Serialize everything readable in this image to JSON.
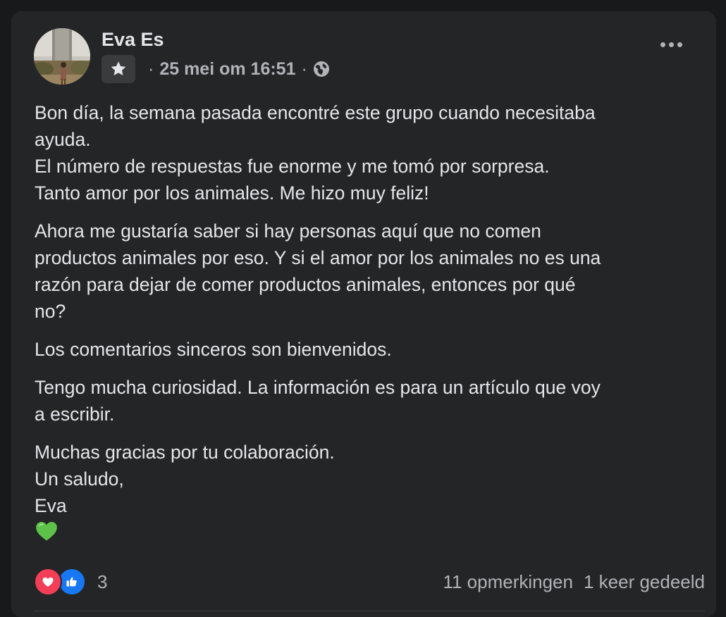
{
  "post": {
    "author": "Eva Es",
    "date": "25 mei om 16:51",
    "separator": "·",
    "paragraphs": [
      [
        "Bon día, la semana pasada encontré este grupo cuando necesitaba",
        "ayuda.",
        "El número de respuestas fue enorme y me tomó por sorpresa.",
        "Tanto amor por los animales. Me hizo muy feliz!"
      ],
      [
        "Ahora me gustaría saber si hay personas aquí que no comen",
        "productos animales por eso. Y si el amor por los animales no es una",
        "razón para dejar de comer productos animales, entonces por qué",
        "no?"
      ],
      [
        "Los comentarios sinceros son bienvenidos."
      ],
      [
        "Tengo mucha curiosidad. La información es para un artículo que voy",
        "a escribir."
      ],
      [
        "Muchas gracias por tu colaboración.",
        "Un saludo,",
        "Eva"
      ]
    ],
    "emoji": "green-heart"
  },
  "footer": {
    "reaction_count": "3",
    "comments": "11 opmerkingen",
    "shares": "1 keer gedeeld"
  },
  "icons": {
    "badge": "star-icon",
    "privacy": "globe-icon",
    "menu": "more-options-icon",
    "reaction_1": "love-reaction-icon",
    "reaction_2": "like-reaction-icon"
  },
  "colors": {
    "background": "#18191a",
    "card": "#242526",
    "primary_text": "#e4e6eb",
    "secondary_text": "#b0b3b8",
    "love": "#f33e58",
    "like": "#1877f2",
    "green_heart": "#5ec24a"
  }
}
